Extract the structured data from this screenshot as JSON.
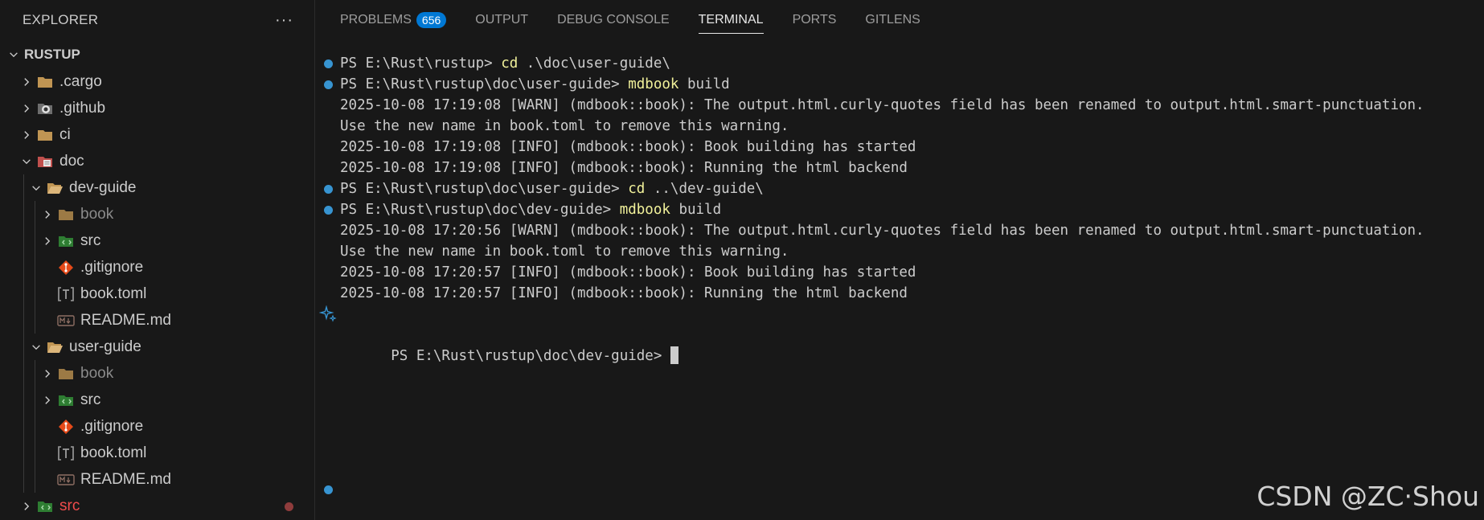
{
  "explorer": {
    "title": "EXPLORER",
    "more_label": "···",
    "root": "RUSTUP",
    "items": [
      {
        "label": ".cargo"
      },
      {
        "label": ".github"
      },
      {
        "label": "ci"
      },
      {
        "label": "doc"
      },
      {
        "label": "dev-guide"
      },
      {
        "label": "book"
      },
      {
        "label": "src"
      },
      {
        "label": ".gitignore"
      },
      {
        "label": "book.toml"
      },
      {
        "label": "README.md"
      },
      {
        "label": "user-guide"
      },
      {
        "label": "book"
      },
      {
        "label": "src"
      },
      {
        "label": ".gitignore"
      },
      {
        "label": "book.toml"
      },
      {
        "label": "README.md"
      },
      {
        "label": "src"
      }
    ],
    "colors": {
      "folder": "#dcb67a",
      "git": "#e64a19",
      "src": "#4caf50",
      "error": "#f14c4c"
    }
  },
  "panel": {
    "tabs": [
      {
        "label": "PROBLEMS",
        "badge": "656"
      },
      {
        "label": "OUTPUT"
      },
      {
        "label": "DEBUG CONSOLE"
      },
      {
        "label": "TERMINAL",
        "active": true
      },
      {
        "label": "PORTS"
      },
      {
        "label": "GITLENS"
      }
    ],
    "accent": "#0078d4"
  },
  "terminal": {
    "lines": [
      {
        "prompt": "PS E:\\Rust\\rustup> ",
        "cmd": "cd",
        "args": " .\\doc\\user-guide\\"
      },
      {
        "prompt": "PS E:\\Rust\\rustup\\doc\\user-guide> ",
        "cmd": "mdbook",
        "args": " build"
      },
      {
        "text": "2025-10-08 17:19:08 [WARN] (mdbook::book): The output.html.curly-quotes field has been renamed to output.html.smart-punctuation."
      },
      {
        "text": "Use the new name in book.toml to remove this warning."
      },
      {
        "text": "2025-10-08 17:19:08 [INFO] (mdbook::book): Book building has started"
      },
      {
        "text": "2025-10-08 17:19:08 [INFO] (mdbook::book): Running the html backend"
      },
      {
        "prompt": "PS E:\\Rust\\rustup\\doc\\user-guide> ",
        "cmd": "cd",
        "args": " ..\\dev-guide\\"
      },
      {
        "prompt": "PS E:\\Rust\\rustup\\doc\\dev-guide> ",
        "cmd": "mdbook",
        "args": " build"
      },
      {
        "text": "2025-10-08 17:20:56 [WARN] (mdbook::book): The output.html.curly-quotes field has been renamed to output.html.smart-punctuation."
      },
      {
        "text": "Use the new name in book.toml to remove this warning."
      },
      {
        "text": "2025-10-08 17:20:57 [INFO] (mdbook::book): Book building has started"
      },
      {
        "text": "2025-10-08 17:20:57 [INFO] (mdbook::book): Running the html backend"
      },
      {
        "prompt": "PS E:\\Rust\\rustup\\doc\\dev-guide> "
      }
    ],
    "command_color": "#f1f19a",
    "decoration_color": "#3794d1"
  },
  "watermark": "CSDN @ZC·Shou"
}
